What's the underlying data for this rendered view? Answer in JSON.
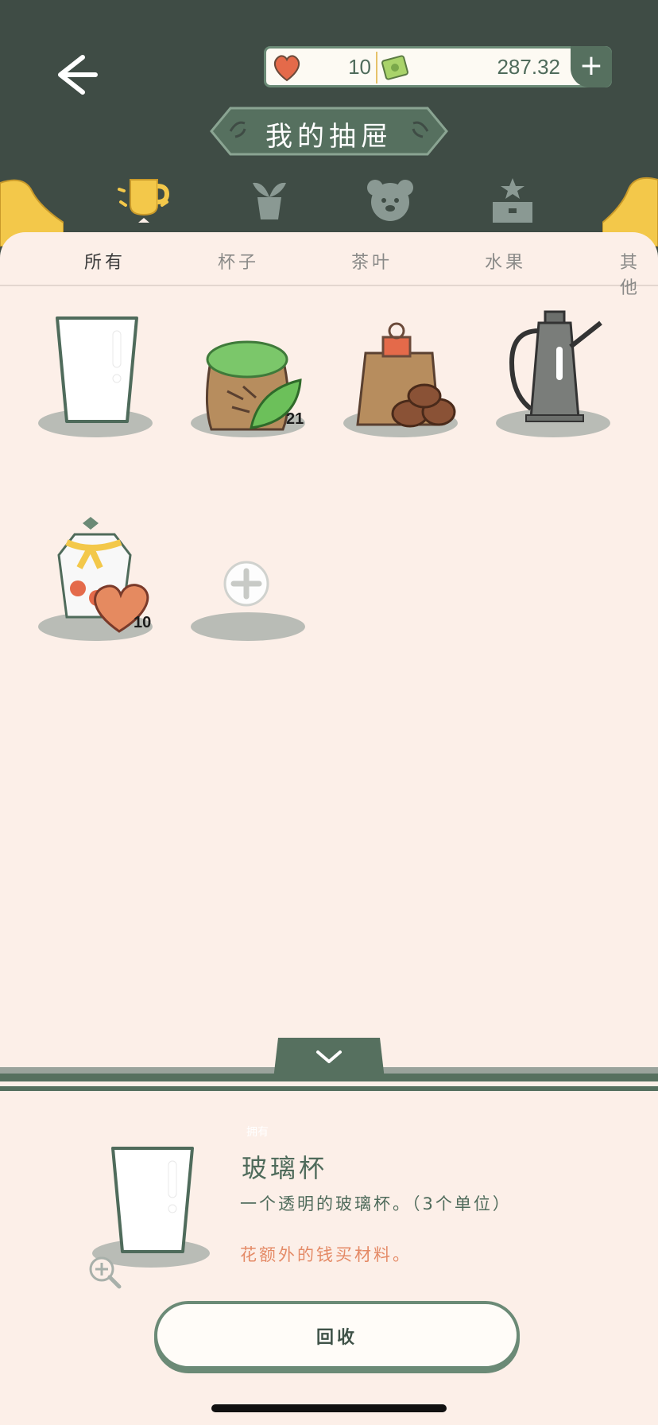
{
  "header": {
    "back_icon": "arrow-left-icon",
    "hearts": "10",
    "money": "287.32",
    "add_icon": "plus-icon",
    "title": "我的抽屉"
  },
  "categories": [
    {
      "icon": "cup-icon",
      "active": true
    },
    {
      "icon": "plant-pot-icon",
      "active": false
    },
    {
      "icon": "bear-icon",
      "active": false
    },
    {
      "icon": "star-trophy-icon",
      "active": false
    }
  ],
  "subtabs": [
    {
      "label": "所有",
      "active": true
    },
    {
      "label": "杯子",
      "active": false
    },
    {
      "label": "茶叶",
      "active": false
    },
    {
      "label": "水果",
      "active": false
    },
    {
      "label": "其他",
      "active": false
    }
  ],
  "items": [
    {
      "name": "glass-cup",
      "count": ""
    },
    {
      "name": "tea-leaf-sack",
      "count": "21"
    },
    {
      "name": "coffee-bean-bag",
      "count": ""
    },
    {
      "name": "coffee-pot",
      "count": ""
    },
    {
      "name": "candy-jar-heart",
      "count": "10"
    },
    {
      "name": "add-slot",
      "count": ""
    }
  ],
  "detail": {
    "owned_label": "拥有",
    "name": "玻璃杯",
    "description": "一个透明的玻璃杯。（3个单位）",
    "hint": "花额外的钱买材料。",
    "zoom_icon": "zoom-in-icon",
    "recycle_label": "回收"
  },
  "colors": {
    "header_bg": "#3f4c45",
    "panel_bg": "#fcefe8",
    "accent_green": "#56705f",
    "hint_orange": "#e48a66",
    "gold": "#f3c84a"
  }
}
